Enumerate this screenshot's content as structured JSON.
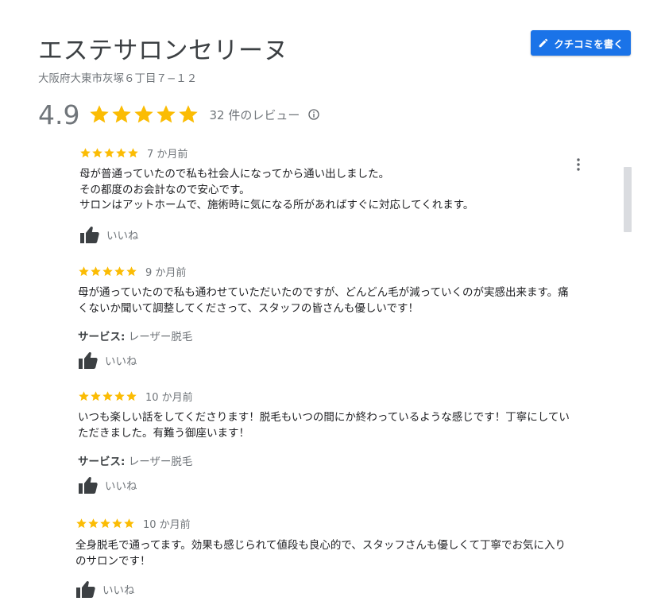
{
  "header": {
    "title": "エステサロンセリーヌ",
    "address": "大阪府大東市灰塚６丁目７−１２",
    "write_review_label": "クチコミを書く"
  },
  "summary": {
    "rating": "4.9",
    "stars": 5,
    "review_count": "32 件のレビュー"
  },
  "reviews": [
    {
      "stars": 5,
      "time": "7 か月前",
      "lines": [
        "母が普通っていたので私も社会人になってから通い出しました。",
        "その都度のお会計なので安心です。",
        "サロンはアットホームで、施術時に気になる所があればすぐに対応してくれます。"
      ],
      "like_label": "いいね"
    },
    {
      "stars": 5,
      "time": "9 か月前",
      "lines": [
        "母が通っていたので私も通わせていただいたのですが、どんどん毛が減っていくのが実感出来ます。痛",
        "くないか聞いて調整してくださって、スタッフの皆さんも優しいです！"
      ],
      "service_label": "サービス:",
      "service_value": "レーザー脱毛",
      "like_label": "いいね"
    },
    {
      "stars": 5,
      "time": "10 か月前",
      "lines": [
        "いつも楽しい話をしてくださります！脱毛もいつの間にか終わっているような感じです！丁寧にしてい",
        "ただきました。有難う御座います！"
      ],
      "service_label": "サービス:",
      "service_value": "レーザー脱毛",
      "like_label": "いいね"
    },
    {
      "stars": 5,
      "time": "10 か月前",
      "lines": [
        "全身脱毛で通ってます。効果も感じられて値段も良心的で、スタッフさんも優しくて丁寧でお気に入り",
        "のサロンです！"
      ],
      "like_label": "いいね"
    }
  ],
  "colors": {
    "star": "#fbbc04",
    "button": "#1a73e8",
    "muted_text": "#70757a"
  },
  "icons": {
    "write": "pencil-icon",
    "info": "info-icon",
    "like": "thumbs-up-icon",
    "more": "more-vert-icon"
  }
}
